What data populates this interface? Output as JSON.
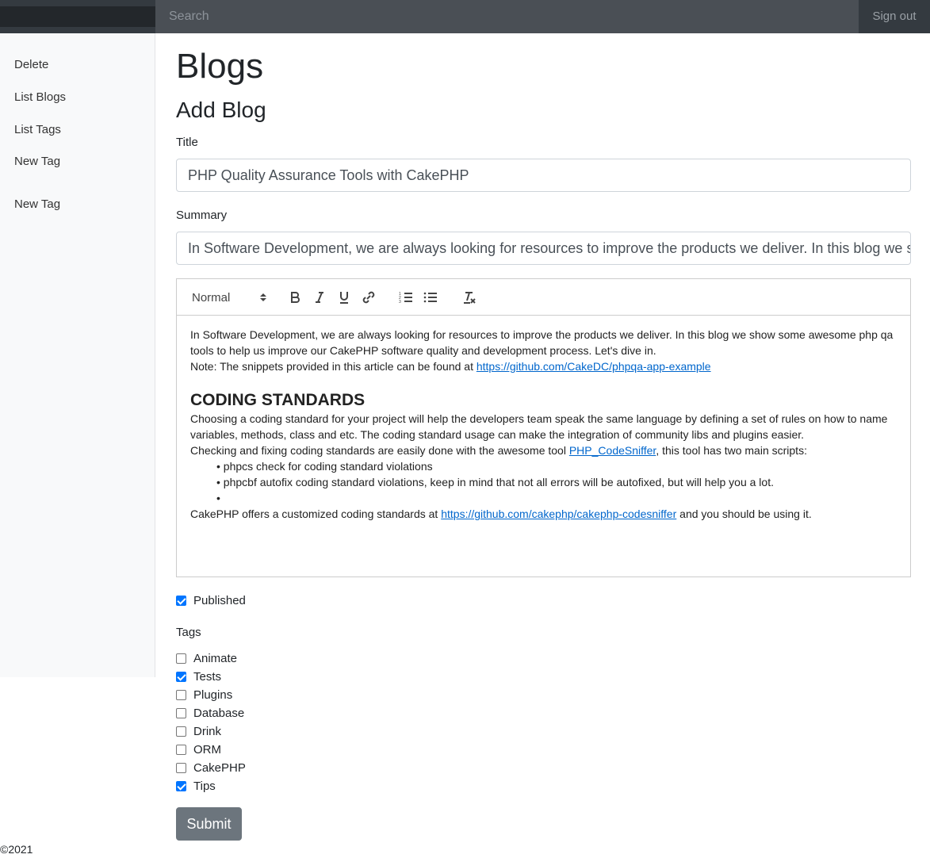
{
  "navbar": {
    "search_placeholder": "Search",
    "signout_label": "Sign out"
  },
  "sidebar": {
    "items": [
      {
        "label": "Delete"
      },
      {
        "label": "List Blogs"
      },
      {
        "label": "List Tags"
      },
      {
        "label": "New Tag"
      },
      {
        "label": "New Tag"
      }
    ]
  },
  "page": {
    "title": "Blogs",
    "subtitle": "Add Blog"
  },
  "form": {
    "title_label": "Title",
    "title_value": "PHP Quality Assurance Tools with CakePHP",
    "summary_label": "Summary",
    "summary_value": "In Software Development, we are always looking for resources to improve the products we deliver. In this blog we show some awesome php qa tools to help us improve our CakePHP software quality and development process. Let's dive in.",
    "editor": {
      "format_select": "Normal",
      "p1": "In Software Development, we are always looking for resources to improve the products we deliver. In this blog we show some awesome php qa tools to help us improve our CakePHP software quality and development process. Let's dive in.",
      "p2_prefix": "Note: The snippets provided in this article can be found at ",
      "p2_link": "https://github.com/CakeDC/phpqa-app-example",
      "heading": "CODING STANDARDS",
      "p3": "Choosing a coding standard for your project will help the developers team speak the same language by defining a set of rules on how to name variables, methods, class and etc. The coding standard usage can make the integration of community libs and plugins easier.",
      "p4_prefix": "Checking and fixing coding standards are easily done with the awesome tool ",
      "p4_link": "PHP_CodeSniffer",
      "p4_suffix": ", this tool has two main scripts:",
      "bullets": [
        "phpcs check for coding standard violations",
        "phpcbf autofix coding standard violations, keep in mind that not all errors will be autofixed, but will help you a lot.",
        ""
      ],
      "p5_prefix": "CakePHP offers a customized coding standards at ",
      "p5_link": "https://github.com/cakephp/cakephp-codesniffer",
      "p5_suffix": " and you should be using it."
    },
    "published_label": "Published",
    "published": true,
    "tags_label": "Tags",
    "tags": [
      {
        "label": "Animate",
        "checked": false
      },
      {
        "label": "Tests",
        "checked": true
      },
      {
        "label": "Plugins",
        "checked": false
      },
      {
        "label": "Database",
        "checked": false
      },
      {
        "label": "Drink",
        "checked": false
      },
      {
        "label": "ORM",
        "checked": false
      },
      {
        "label": "CakePHP",
        "checked": false
      },
      {
        "label": "Tips",
        "checked": true
      }
    ],
    "submit_label": "Submit"
  },
  "footer": {
    "copyright": "©2021"
  },
  "colors": {
    "navbar": "#343a40",
    "checkbox_checked": "#0075ff",
    "link": "#0066cc",
    "submit": "#6c757d"
  }
}
